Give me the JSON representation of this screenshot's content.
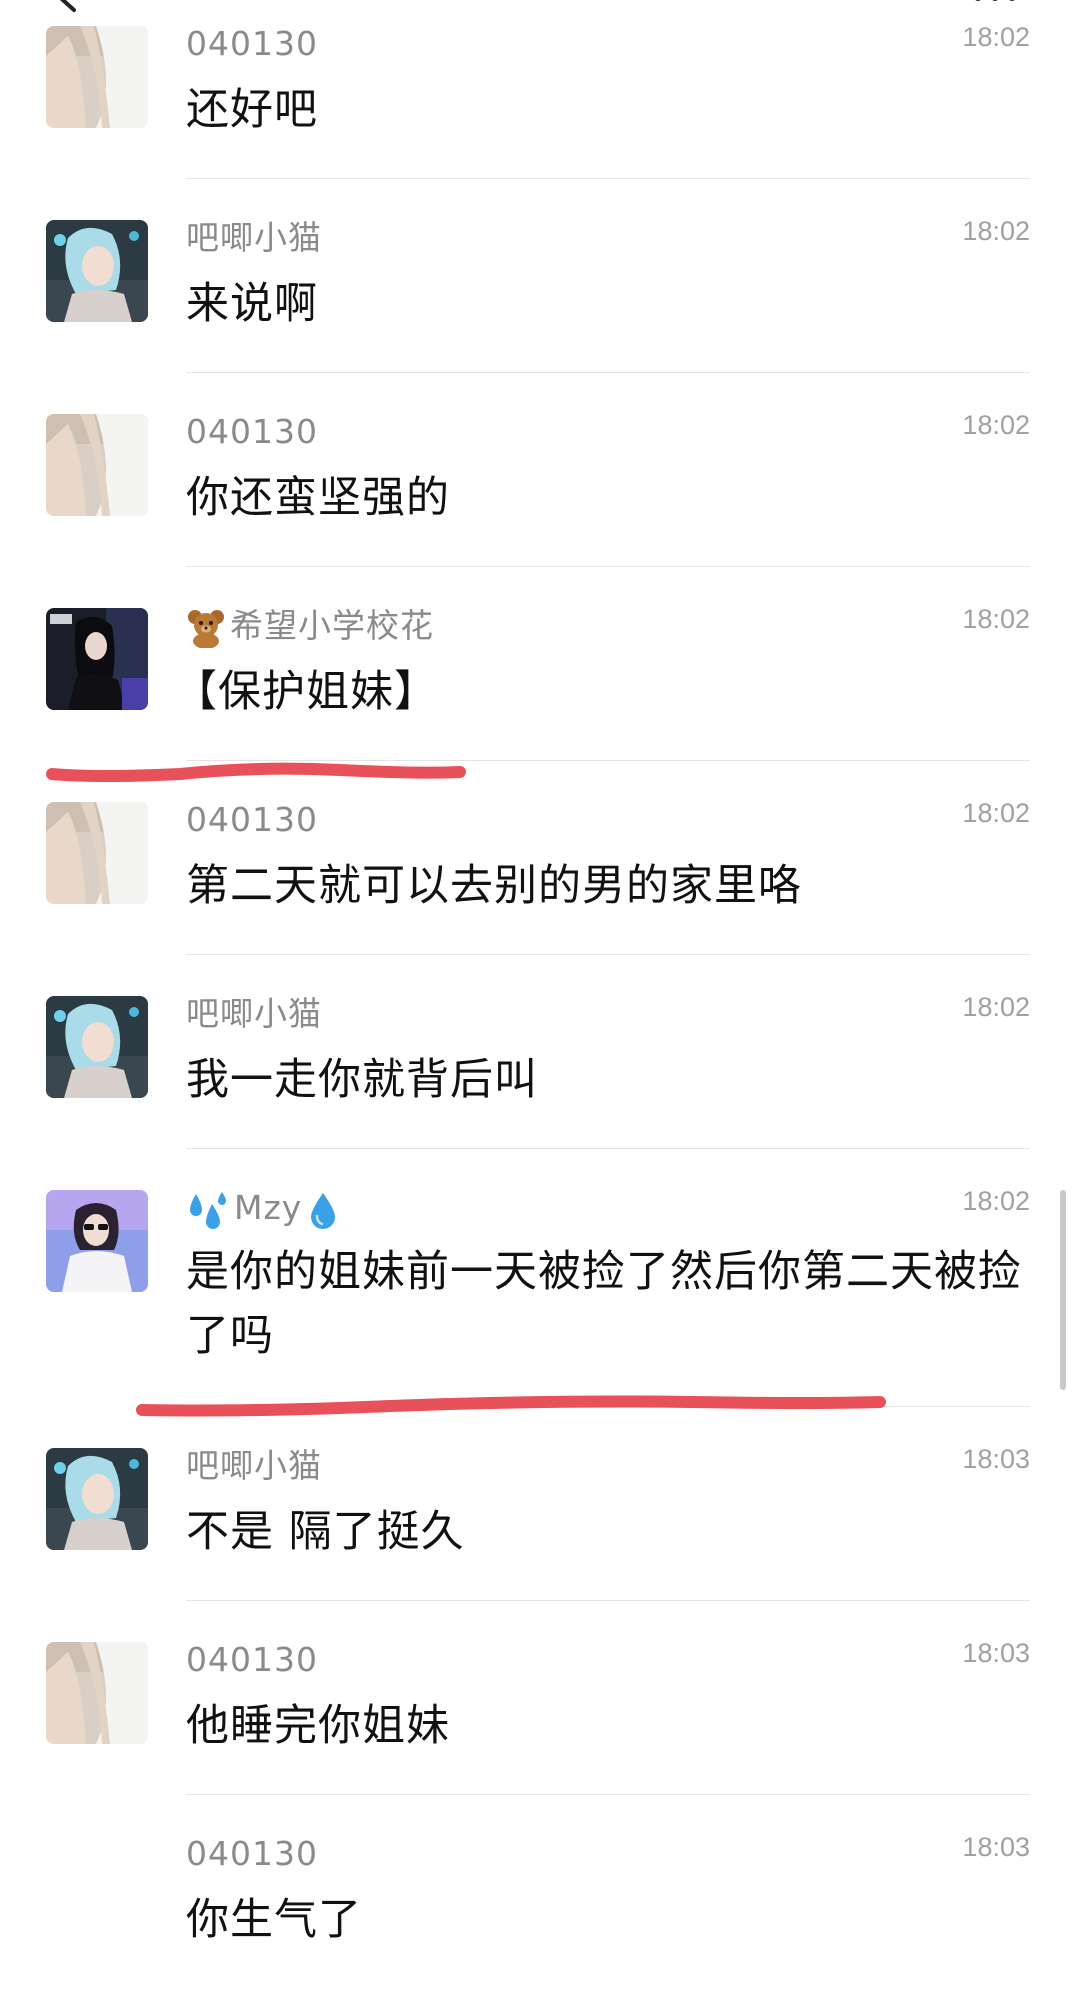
{
  "messages": [
    {
      "name": "040130",
      "time": "18:02",
      "text": "还好吧",
      "avatar": "white-dress-avatar"
    },
    {
      "name": "吧唧小猫",
      "time": "18:02",
      "text": "来说啊",
      "avatar": "blue-hair-avatar"
    },
    {
      "name": "040130",
      "time": "18:02",
      "text": "你还蛮坚强的",
      "avatar": "white-dress-avatar"
    },
    {
      "name": "希望小学校花",
      "name_emoji": "teddy-bear-icon",
      "time": "18:02",
      "text": "【保护姐妹】",
      "avatar": "dark-hair-avatar"
    },
    {
      "name": "040130",
      "time": "18:02",
      "text": "第二天就可以去别的男的家里咯",
      "avatar": "white-dress-avatar"
    },
    {
      "name": "吧唧小猫",
      "time": "18:02",
      "text": "我一走你就背后叫",
      "avatar": "blue-hair-avatar"
    },
    {
      "name": "Mzy",
      "name_emoji": "sweat-droplets-icon",
      "name_suffix_emoji": "droplet-icon",
      "time": "18:02",
      "text": "是你的姐妹前一天被捡了然后你第二天被捡了吗",
      "avatar": "sunglasses-avatar"
    },
    {
      "name": "吧唧小猫",
      "time": "18:03",
      "text": "不是 隔了挺久",
      "avatar": "blue-hair-avatar"
    },
    {
      "name": "040130",
      "time": "18:03",
      "text": "他睡完你姐妹",
      "avatar": "white-dress-avatar"
    },
    {
      "name": "040130",
      "time": "18:03",
      "text": "你生气了",
      "avatar": "none"
    }
  ],
  "colors": {
    "name": "#8a8a8a",
    "time": "#a0a0a0",
    "text": "#111111",
    "divider": "#e4e4e4",
    "annotation": "#e8515a"
  }
}
